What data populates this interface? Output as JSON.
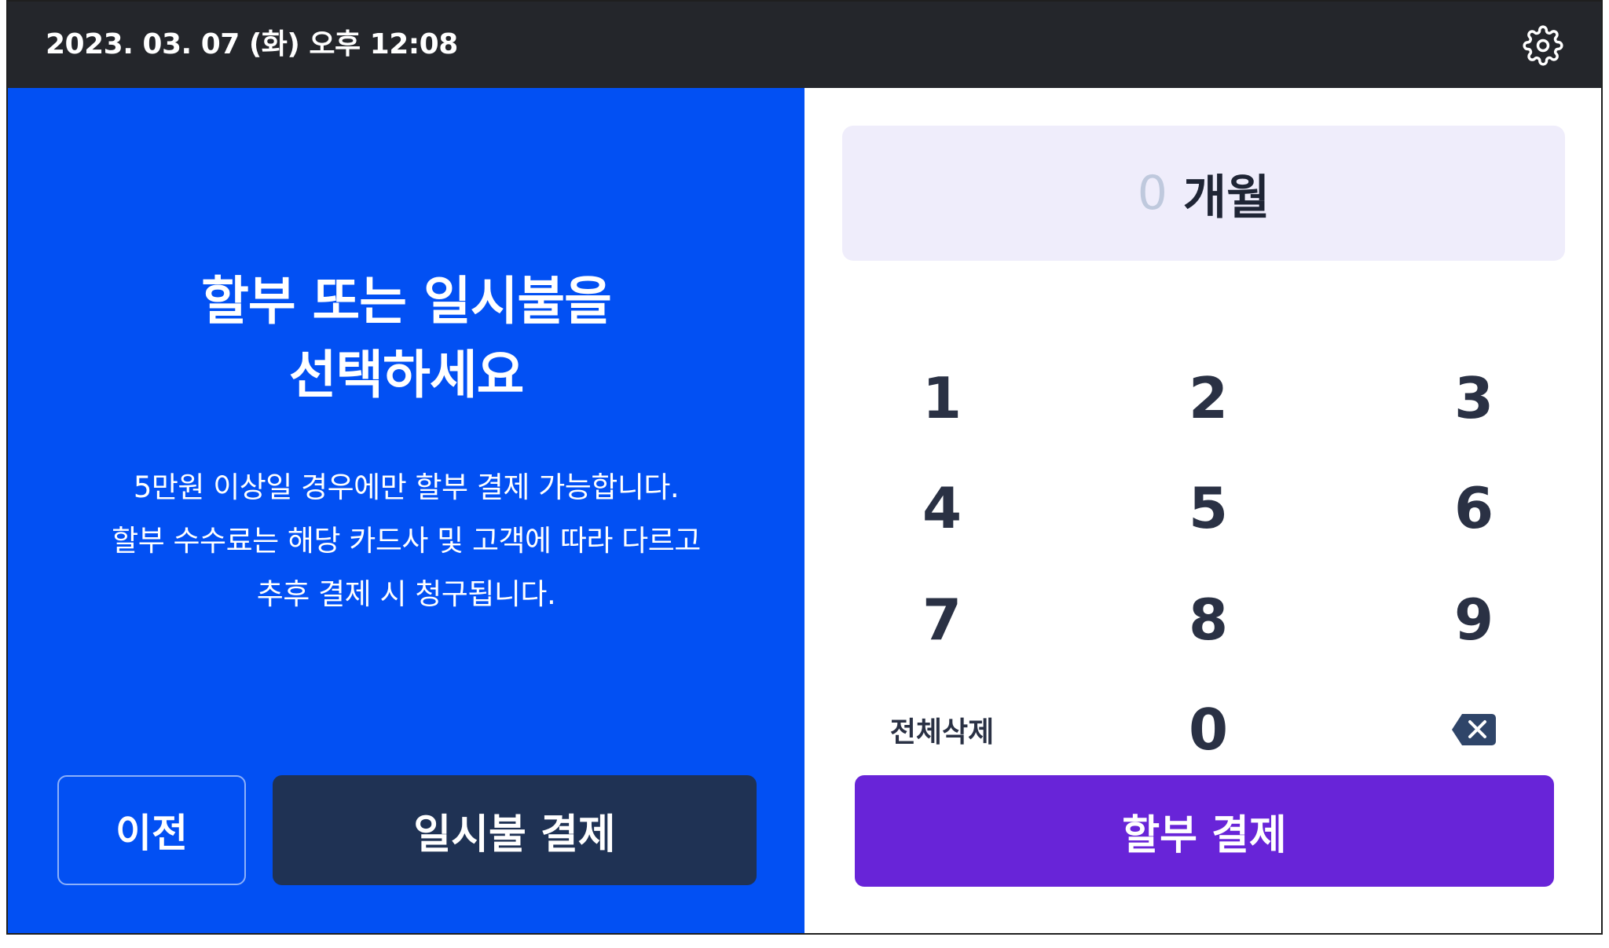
{
  "header": {
    "datetime": "2023. 03. 07 (화) 오후 12:08",
    "settings_icon": "gear-icon"
  },
  "left_panel": {
    "heading_line1": "할부 또는 일시불을",
    "heading_line2": "선택하세요",
    "desc_line1": "5만원 이상일 경우에만 할부 결제 가능합니다.",
    "desc_line2": "할부 수수료는 해당 카드사 및 고객에 따라 다르고",
    "desc_line3": "추후 결제 시 청구됩니다.",
    "prev_label": "이전",
    "lump_sum_label": "일시불 결제"
  },
  "right_panel": {
    "display_value": "0",
    "display_unit": "개월",
    "keys": {
      "k1": "1",
      "k2": "2",
      "k3": "3",
      "k4": "4",
      "k5": "5",
      "k6": "6",
      "k7": "7",
      "k8": "8",
      "k9": "9",
      "clear_all": "전체삭제",
      "k0": "0",
      "backspace_icon": "backspace-icon"
    },
    "installment_label": "할부 결제"
  },
  "colors": {
    "topbar": "#24262b",
    "left_panel_bg": "#0250f3",
    "lump_sum_button": "#1f3254",
    "installment_button": "#6824d8",
    "display_bg": "#efedfb",
    "key_text": "#2a3144"
  }
}
